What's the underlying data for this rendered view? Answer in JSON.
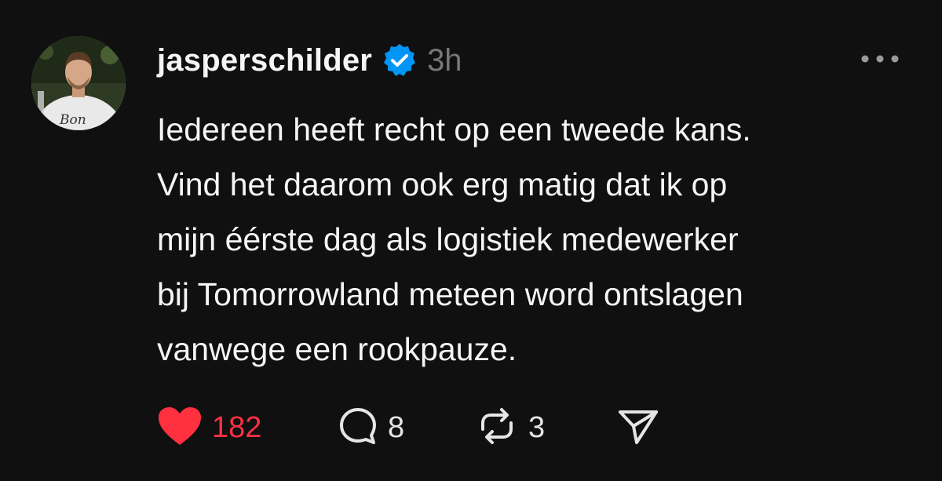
{
  "post": {
    "username": "jasperschilder",
    "timestamp": "3h",
    "avatar_caption": "Bon",
    "body_lines": [
      "Iedereen heeft recht op een tweede kans.",
      "Vind het daarom ook erg matig dat ik op",
      "mijn éérste dag als logistiek medewerker",
      "bij Tomorrowland meteen word ontslagen",
      "vanwege een rookpauze."
    ],
    "verified": true
  },
  "actions": {
    "like": {
      "count": "182",
      "icon": "heart-icon",
      "liked": true
    },
    "reply": {
      "count": "8",
      "icon": "speech-bubble-icon"
    },
    "repost": {
      "count": "3",
      "icon": "repost-icon"
    },
    "share": {
      "icon": "send-icon"
    }
  },
  "colors": {
    "background": "#101010",
    "text": "#f3f5f7",
    "muted": "#777777",
    "like": "#ff3040",
    "verified": "#0095f6"
  }
}
